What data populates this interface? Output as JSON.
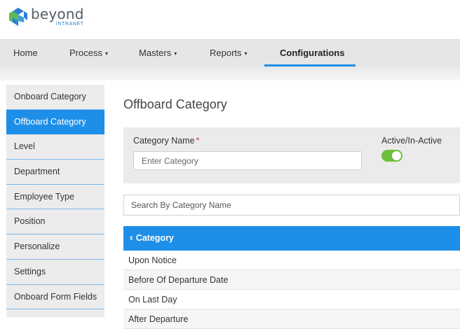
{
  "brand": {
    "name": "beyond",
    "sub": "INTRANET",
    "colors": {
      "blue": "#2a7fd0",
      "green": "#5cb85c"
    }
  },
  "nav": {
    "items": [
      {
        "label": "Home",
        "caret": ""
      },
      {
        "label": "Process",
        "caret": "▾"
      },
      {
        "label": "Masters",
        "caret": "▾"
      },
      {
        "label": "Reports",
        "caret": "▾"
      },
      {
        "label": "Configurations",
        "caret": ""
      }
    ],
    "active_index": 4
  },
  "sidebar": {
    "items": [
      {
        "label": "Onboard Category"
      },
      {
        "label": "Offboard Category"
      },
      {
        "label": "Level"
      },
      {
        "label": "Department"
      },
      {
        "label": "Employee Type"
      },
      {
        "label": "Position"
      },
      {
        "label": "Personalize"
      },
      {
        "label": "Settings"
      },
      {
        "label": "Onboard Form Fields"
      }
    ],
    "active_index": 1
  },
  "page": {
    "title": "Offboard Category"
  },
  "form": {
    "category_label": "Category Name",
    "required_mark": "*",
    "category_placeholder": "Enter Category",
    "active_label": "Active/In-Active",
    "active_on": true
  },
  "search": {
    "placeholder": "Search By Category Name"
  },
  "table": {
    "sort_icon": "⇕",
    "header": "Category",
    "rows": [
      "Upon Notice",
      "Before Of Departure Date",
      "On Last Day",
      "After Departure"
    ]
  },
  "colors": {
    "accent": "#1e8fe8",
    "toggle_on": "#6fbf3e",
    "required": "#e0322e"
  }
}
